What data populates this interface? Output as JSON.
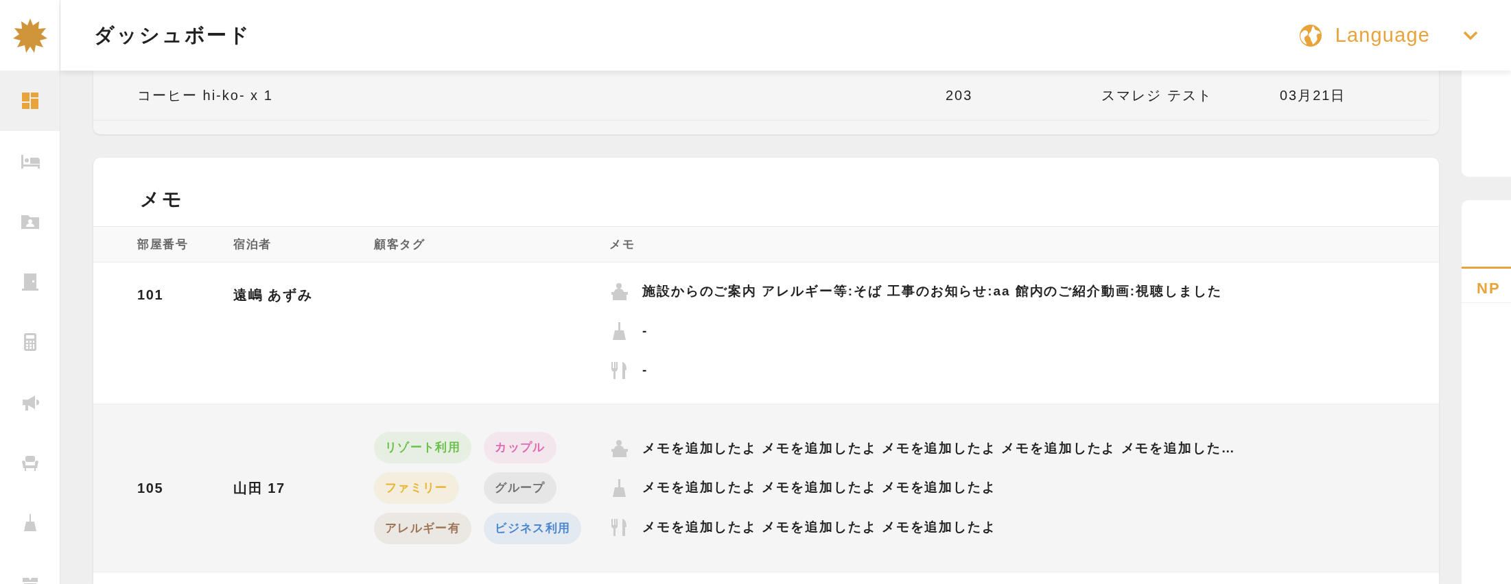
{
  "sidebar": {
    "items": [
      {
        "kind": "dashboard",
        "selected": true
      },
      {
        "kind": "bed",
        "selected": false
      },
      {
        "kind": "guest-folder",
        "selected": false
      },
      {
        "kind": "door",
        "selected": false
      },
      {
        "kind": "calculator",
        "selected": false
      },
      {
        "kind": "megaphone",
        "selected": false
      },
      {
        "kind": "armchair",
        "selected": false
      },
      {
        "kind": "broom",
        "selected": false
      },
      {
        "kind": "gift",
        "selected": false
      }
    ]
  },
  "header": {
    "title": "ダッシュボード",
    "language": "Language"
  },
  "order_table": {
    "rows": [
      {
        "item": "コーヒー hi-ko- x 1",
        "room": "203",
        "guest": "スマレジ テスト",
        "date": "03月21日"
      }
    ]
  },
  "memo_card": {
    "title": "メモ",
    "columns": [
      "部屋番号",
      "宿泊者",
      "顧客タグ",
      "メモ"
    ],
    "rows": [
      {
        "room": "101",
        "guest": "遠嶋 あずみ",
        "tags": [],
        "memos": [
          {
            "kind": "reception",
            "text": "施設からのご案内 アレルギー等:そば 工事のお知らせ:aa 館内のご紹介動画:視聴しました"
          },
          {
            "kind": "cleaning",
            "text": "-"
          },
          {
            "kind": "meal",
            "text": "-"
          }
        ]
      },
      {
        "room": "105",
        "guest": "山田 17",
        "tags": [
          {
            "label": "リゾート利用",
            "color": "#6bbf4a"
          },
          {
            "label": "カップル",
            "color": "#e06ab0"
          },
          {
            "label": "ファミリー",
            "color": "#e9b431"
          },
          {
            "label": "グループ",
            "color": "#707070"
          },
          {
            "label": "アレルギー有",
            "color": "#9c7456"
          },
          {
            "label": "ビジネス利用",
            "color": "#4a86d0"
          }
        ],
        "memos": [
          {
            "kind": "reception",
            "text": "メモを追加したよ メモを追加したよ メモを追加したよ メモを追加したよ メモを追加した…"
          },
          {
            "kind": "cleaning",
            "text": "メモを追加したよ メモを追加したよ メモを追加したよ"
          },
          {
            "kind": "meal",
            "text": "メモを追加したよ メモを追加したよ メモを追加したよ"
          }
        ]
      }
    ]
  },
  "side_panel": {
    "tab": "NP"
  }
}
